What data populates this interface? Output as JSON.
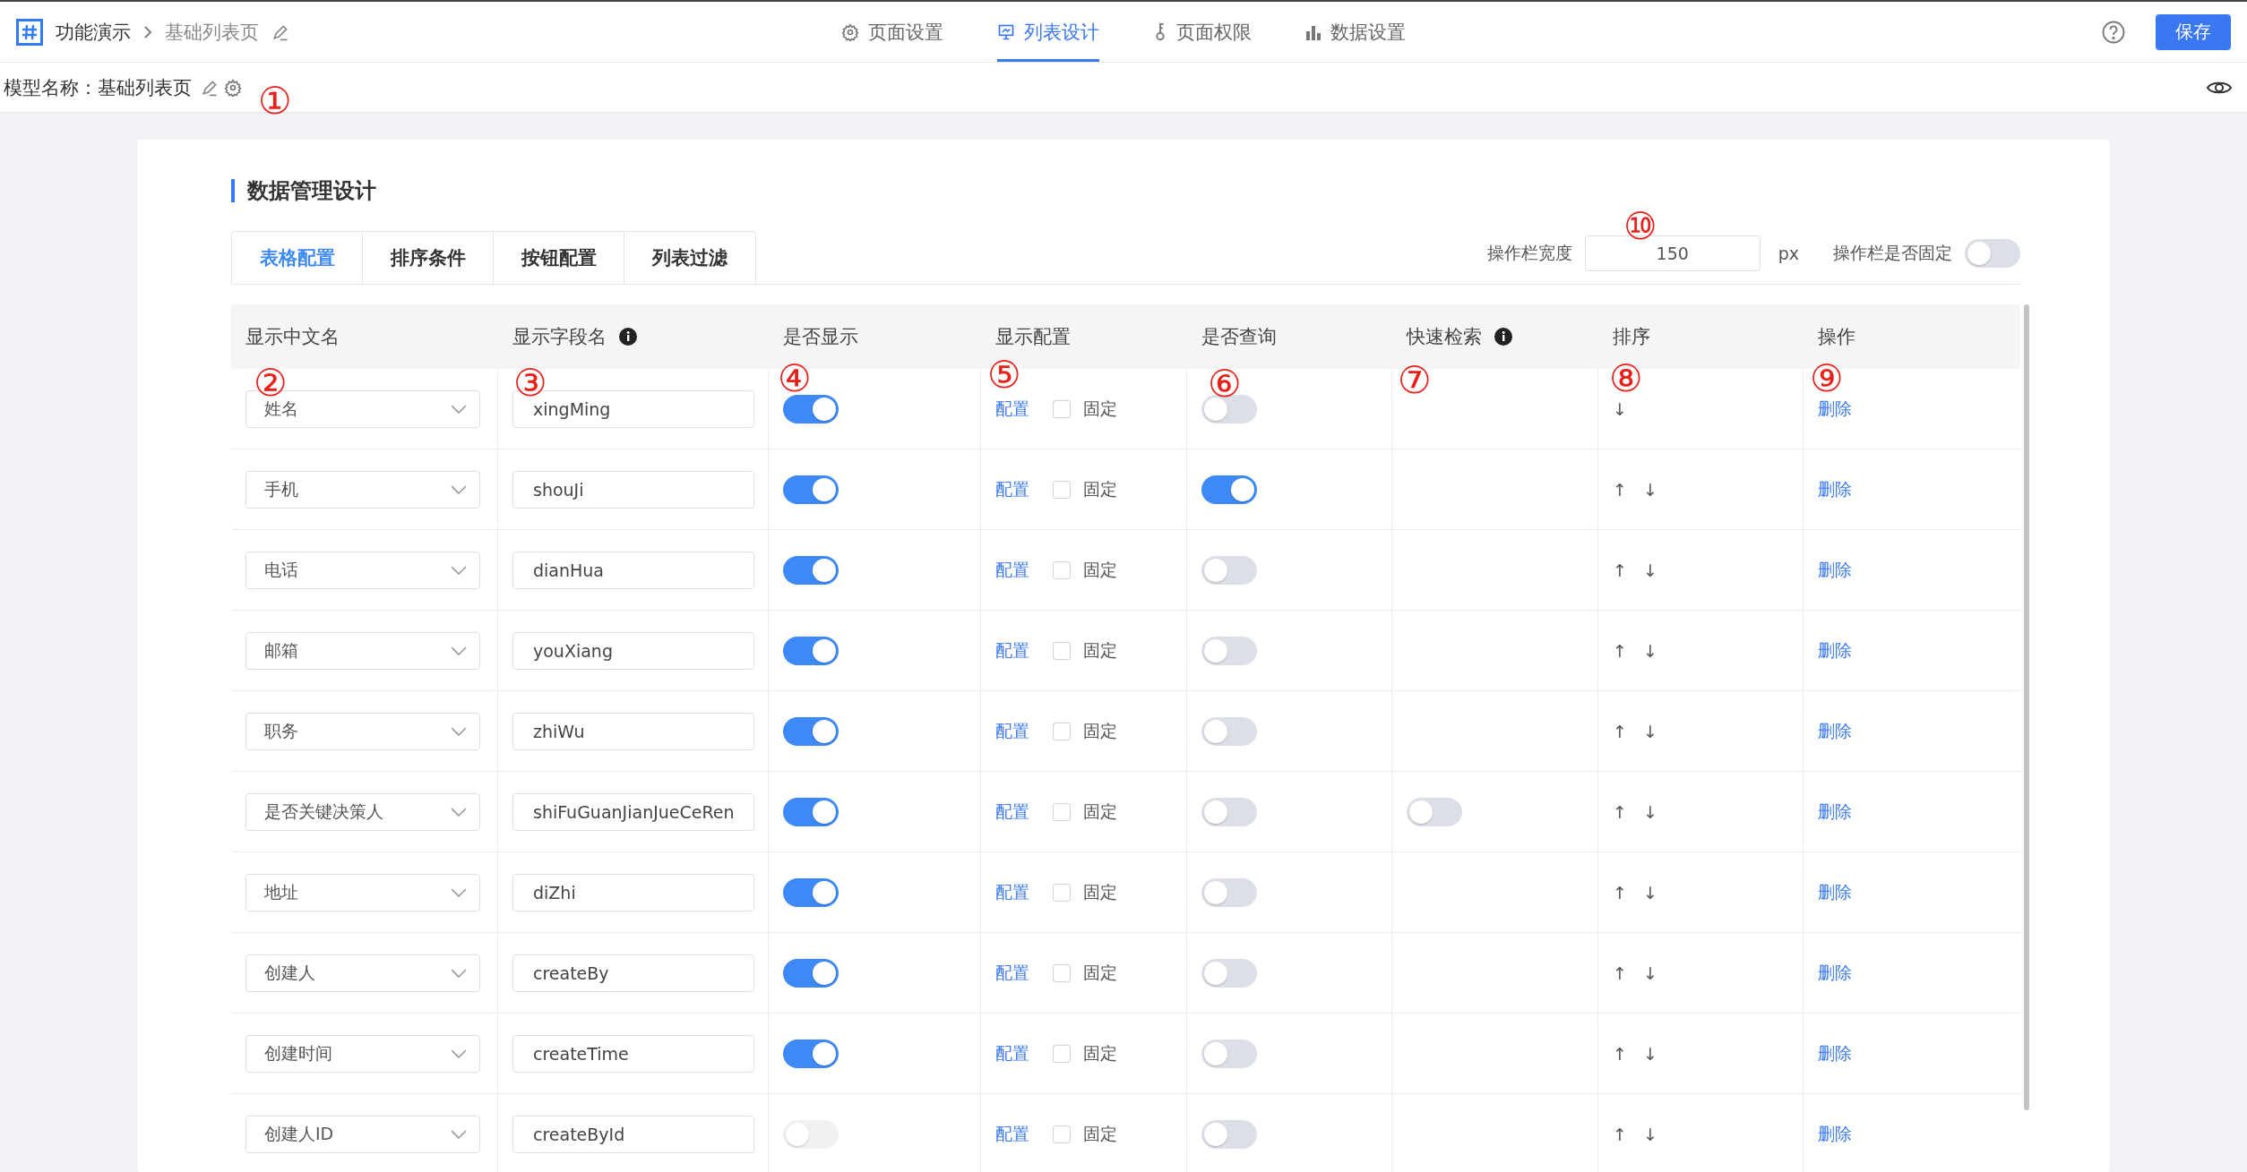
{
  "header": {
    "breadcrumb": [
      "功能演示",
      "基础列表页"
    ],
    "nav_tabs": [
      {
        "label": "页面设置",
        "kind": "gear",
        "selected": false
      },
      {
        "label": "列表设计",
        "kind": "board",
        "selected": true
      },
      {
        "label": "页面权限",
        "kind": "key",
        "selected": false
      },
      {
        "label": "数据设置",
        "kind": "chart",
        "selected": false
      }
    ],
    "save_button": "保存"
  },
  "model_bar": {
    "label": "模型名称：",
    "name": "基础列表页"
  },
  "section_title": "数据管理设计",
  "tabs": [
    {
      "label": "表格配置",
      "selected": true
    },
    {
      "label": "排序条件",
      "selected": false
    },
    {
      "label": "按钮配置",
      "selected": false
    },
    {
      "label": "列表过滤",
      "selected": false
    }
  ],
  "action_width": {
    "label": "操作栏宽度",
    "value": "150",
    "unit": "px"
  },
  "action_fixed": {
    "label": "操作栏是否固定",
    "on": false
  },
  "table": {
    "columns": [
      {
        "label": "显示中文名",
        "info": false
      },
      {
        "label": "显示字段名",
        "info": true
      },
      {
        "label": "是否显示",
        "info": false
      },
      {
        "label": "显示配置",
        "info": false
      },
      {
        "label": "是否查询",
        "info": false
      },
      {
        "label": "快速检索",
        "info": true
      },
      {
        "label": "排序",
        "info": false
      },
      {
        "label": "操作",
        "info": false
      }
    ],
    "rows": [
      {
        "name": "姓名",
        "field": "xingMing",
        "show": {
          "on": true,
          "disabled": false
        },
        "config": "配置",
        "fixed_label": "固定",
        "fixed": false,
        "query": false,
        "sort": [
          "↓"
        ],
        "action": "删除"
      },
      {
        "name": "手机",
        "field": "shouJi",
        "show": {
          "on": true,
          "disabled": false
        },
        "config": "配置",
        "fixed_label": "固定",
        "fixed": false,
        "query": true,
        "sort": [
          "↑",
          "↓"
        ],
        "action": "删除"
      },
      {
        "name": "电话",
        "field": "dianHua",
        "show": {
          "on": true,
          "disabled": false
        },
        "config": "配置",
        "fixed_label": "固定",
        "fixed": false,
        "query": false,
        "sort": [
          "↑",
          "↓"
        ],
        "action": "删除"
      },
      {
        "name": "邮箱",
        "field": "youXiang",
        "show": {
          "on": true,
          "disabled": false
        },
        "config": "配置",
        "fixed_label": "固定",
        "fixed": false,
        "query": false,
        "sort": [
          "↑",
          "↓"
        ],
        "action": "删除"
      },
      {
        "name": "职务",
        "field": "zhiWu",
        "show": {
          "on": true,
          "disabled": false
        },
        "config": "配置",
        "fixed_label": "固定",
        "fixed": false,
        "query": false,
        "sort": [
          "↑",
          "↓"
        ],
        "action": "删除"
      },
      {
        "name": "是否关键决策人",
        "field": "shiFuGuanJianJueCeRen",
        "show": {
          "on": true,
          "disabled": false
        },
        "config": "配置",
        "fixed_label": "固定",
        "fixed": false,
        "query": false,
        "quick_search": {
          "on": false
        },
        "sort": [
          "↑",
          "↓"
        ],
        "action": "删除"
      },
      {
        "name": "地址",
        "field": "diZhi",
        "show": {
          "on": true,
          "disabled": false
        },
        "config": "配置",
        "fixed_label": "固定",
        "fixed": false,
        "query": false,
        "sort": [
          "↑",
          "↓"
        ],
        "action": "删除"
      },
      {
        "name": "创建人",
        "field": "createBy",
        "show": {
          "on": true,
          "disabled": false
        },
        "config": "配置",
        "fixed_label": "固定",
        "fixed": false,
        "query": false,
        "sort": [
          "↑",
          "↓"
        ],
        "action": "删除"
      },
      {
        "name": "创建时间",
        "field": "createTime",
        "show": {
          "on": true,
          "disabled": false
        },
        "config": "配置",
        "fixed_label": "固定",
        "fixed": false,
        "query": false,
        "sort": [
          "↑",
          "↓"
        ],
        "action": "删除"
      },
      {
        "name": "创建人ID",
        "field": "createById",
        "show": {
          "on": false,
          "disabled": true
        },
        "config": "配置",
        "fixed_label": "固定",
        "fixed": false,
        "query": false,
        "sort": [
          "↑",
          "↓"
        ],
        "action": "删除"
      }
    ]
  },
  "annotations": [
    "①",
    "②",
    "③",
    "④",
    "⑤",
    "⑥",
    "⑦",
    "⑧",
    "⑨",
    "⑩"
  ]
}
